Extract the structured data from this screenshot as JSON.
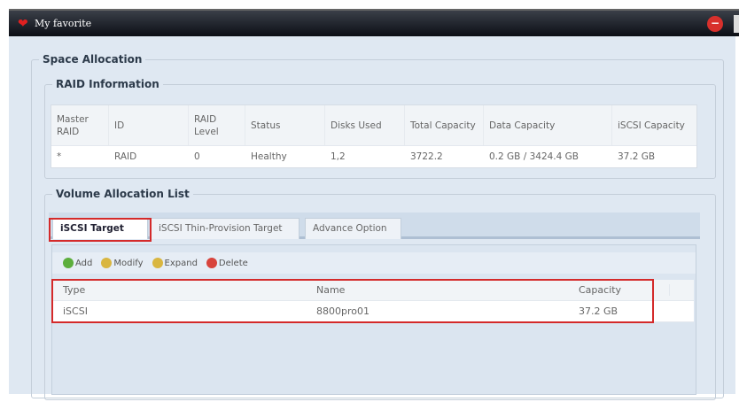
{
  "window": {
    "title": "My favorite"
  },
  "space_allocation": {
    "legend": "Space Allocation",
    "raid_info": {
      "legend": "RAID Information",
      "columns": [
        "Master RAID",
        "ID",
        "RAID Level",
        "Status",
        "Disks Used",
        "Total Capacity",
        "Data Capacity",
        "iSCSI Capacity"
      ],
      "rows": [
        [
          "*",
          "RAID",
          "0",
          "Healthy",
          "1,2",
          "3722.2",
          "0.2 GB / 3424.4 GB",
          "37.2 GB"
        ]
      ]
    }
  },
  "volume_list": {
    "legend": "Volume Allocation List",
    "tabs": [
      "iSCSI Target",
      "iSCSI Thin-Provision Target",
      "Advance Option"
    ],
    "toolbar": {
      "add": "Add",
      "modify": "Modify",
      "expand": "Expand",
      "delete": "Delete"
    },
    "columns": [
      "Type",
      "Name",
      "Capacity"
    ],
    "rows": [
      [
        "iSCSI",
        "8800pro01",
        "37.2 GB"
      ]
    ]
  },
  "colors": {
    "highlight": "#d42a2a"
  }
}
